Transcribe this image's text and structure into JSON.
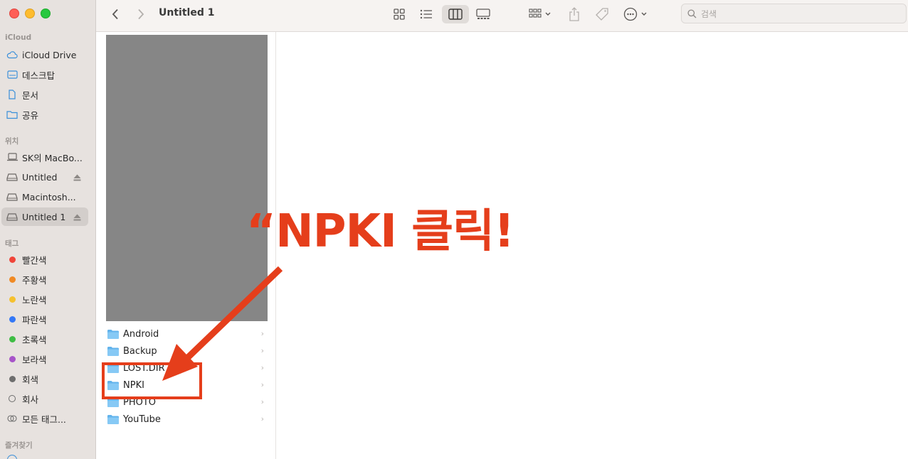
{
  "window": {
    "title": "Untitled 1",
    "buttons": [
      "close",
      "minimize",
      "zoom"
    ]
  },
  "sidebar": {
    "sections": [
      {
        "title": "iCloud",
        "items": [
          {
            "label": "iCloud Drive",
            "icon": "cloud-icon"
          },
          {
            "label": "데스크탑",
            "icon": "desktop-icon"
          },
          {
            "label": "문서",
            "icon": "document-icon"
          },
          {
            "label": "공유",
            "icon": "shared-folder-icon"
          }
        ]
      },
      {
        "title": "위치",
        "items": [
          {
            "label": "SK의 MacBo...",
            "icon": "laptop-icon"
          },
          {
            "label": "Untitled",
            "icon": "drive-icon",
            "eject": true
          },
          {
            "label": "Macintosh...",
            "icon": "drive-icon"
          },
          {
            "label": "Untitled 1",
            "icon": "drive-icon",
            "eject": true,
            "selected": true
          }
        ]
      },
      {
        "title": "태그",
        "items": [
          {
            "label": "빨간색",
            "color": "#f0453a"
          },
          {
            "label": "주황색",
            "color": "#f08a24"
          },
          {
            "label": "노란색",
            "color": "#f5c12f"
          },
          {
            "label": "파란색",
            "color": "#3478f6"
          },
          {
            "label": "초록색",
            "color": "#3fbd45"
          },
          {
            "label": "보라색",
            "color": "#a754c9"
          },
          {
            "label": "회색",
            "color": "#6e6e6e"
          },
          {
            "label": "회사",
            "color": "none"
          },
          {
            "label": "모든 태그...",
            "icon": "all-tags-icon"
          }
        ]
      },
      {
        "title": "즐겨찾기",
        "items": []
      }
    ]
  },
  "toolbar": {
    "back": "back-chevron-icon",
    "forward": "forward-chevron-icon",
    "views": [
      "icon-view",
      "list-view",
      "column-view",
      "gallery-view"
    ],
    "active_view": "column-view",
    "search_placeholder": "검색"
  },
  "files": [
    {
      "name": "Android"
    },
    {
      "name": "Backup"
    },
    {
      "name": "LOST.DIR"
    },
    {
      "name": "NPKI"
    },
    {
      "name": "PHOTO"
    },
    {
      "name": "YouTube"
    }
  ],
  "annotation": {
    "text": "“NPKI 클릭!",
    "color": "#e53e1b"
  }
}
